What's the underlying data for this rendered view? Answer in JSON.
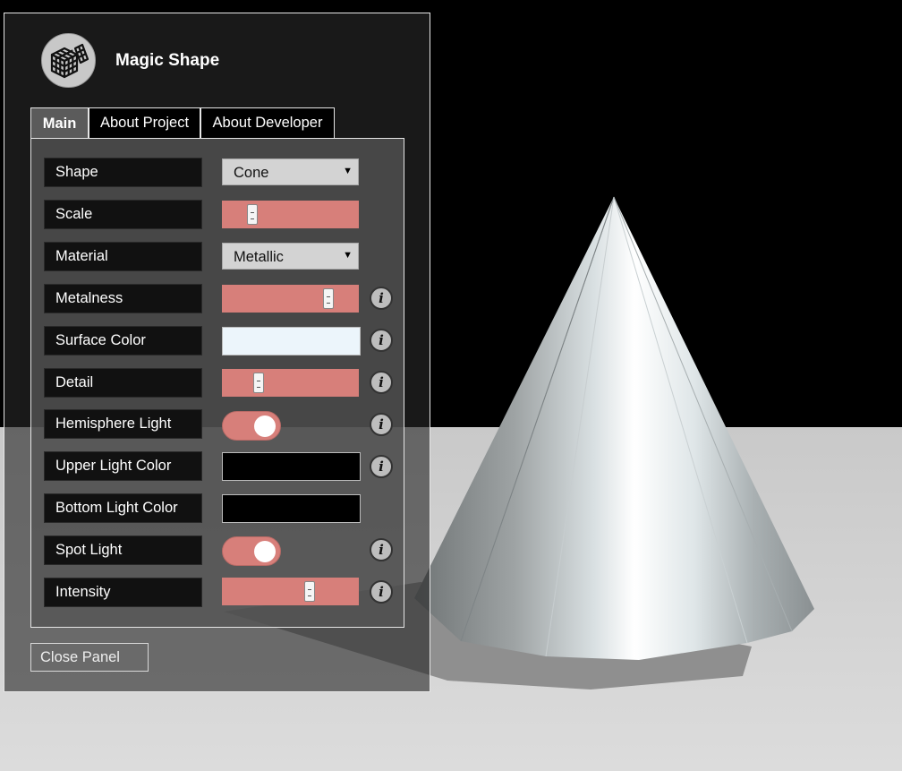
{
  "app": {
    "title": "Magic Shape",
    "logo_icon": "rubiks-cube-icon"
  },
  "tabs": [
    {
      "label": "Main",
      "active": true
    },
    {
      "label": "About Project",
      "active": false
    },
    {
      "label": "About Developer",
      "active": false
    }
  ],
  "controls": {
    "shape": {
      "label": "Shape",
      "value": "Cone"
    },
    "scale": {
      "label": "Scale",
      "value_fraction": 0.2
    },
    "material": {
      "label": "Material",
      "value": "Metallic"
    },
    "metalness": {
      "label": "Metalness",
      "value_fraction": 0.8,
      "info_icon": "info-icon"
    },
    "surface_color": {
      "label": "Surface Color",
      "color": "#ecf5fb",
      "info_icon": "info-icon"
    },
    "detail": {
      "label": "Detail",
      "value_fraction": 0.25,
      "info_icon": "info-icon"
    },
    "hemisphere_light": {
      "label": "Hemisphere Light",
      "on": true,
      "info_icon": "info-icon"
    },
    "upper_light_color": {
      "label": "Upper Light Color",
      "color": "#000000",
      "info_icon": "info-icon"
    },
    "bottom_light_color": {
      "label": "Bottom Light Color",
      "color": "#000000"
    },
    "spot_light": {
      "label": "Spot Light",
      "on": true,
      "info_icon": "info-icon"
    },
    "intensity": {
      "label": "Intensity",
      "value_fraction": 0.65,
      "info_icon": "info-icon"
    }
  },
  "info_glyph": "i",
  "close_button": {
    "label": "Close Panel"
  },
  "colors": {
    "slider_track": "#d77f7a",
    "toggle_on": "#d77f7a",
    "panel_border": "#e6e6e6"
  }
}
